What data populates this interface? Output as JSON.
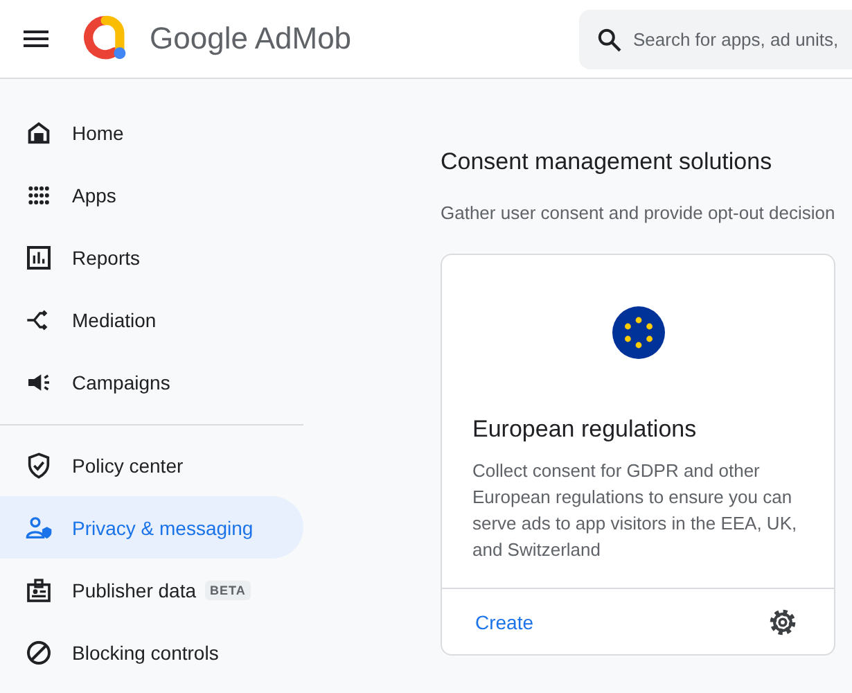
{
  "header": {
    "product_name": "Google AdMob",
    "search": {
      "placeholder": "Search for apps, ad units,"
    }
  },
  "sidebar": {
    "groups": [
      [
        {
          "label": "Home",
          "selected": false
        },
        {
          "label": "Apps",
          "selected": false
        },
        {
          "label": "Reports",
          "selected": false
        },
        {
          "label": "Mediation",
          "selected": false
        },
        {
          "label": "Campaigns",
          "selected": false
        }
      ],
      [
        {
          "label": "Policy center",
          "selected": false
        },
        {
          "label": "Privacy & messaging",
          "selected": true
        },
        {
          "label": "Publisher data",
          "selected": false,
          "badge": "BETA"
        },
        {
          "label": "Blocking controls",
          "selected": false
        }
      ]
    ]
  },
  "main": {
    "title": "Consent management solutions",
    "description": "Gather user consent and provide opt-out decision",
    "card": {
      "title": "European regulations",
      "text": "Collect consent for GDPR and other European regulations to ensure you can serve ads to app visitors in the EEA, UK, and Switzerland",
      "action": "Create"
    }
  }
}
